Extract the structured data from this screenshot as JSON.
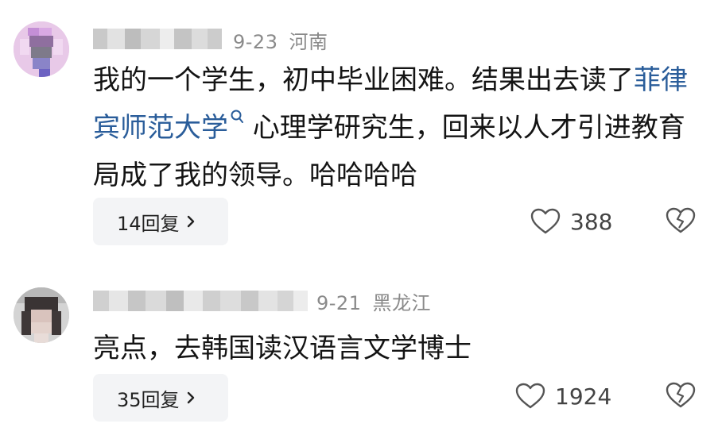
{
  "comments": [
    {
      "date": "9-23",
      "location": "河南",
      "content_before": "我的一个学生，初中毕业困难。结果出去读了",
      "link_text": "菲律宾师范大学",
      "content_after": " 心理学研究生，回来以人才引进教育局成了我的领导。哈哈哈哈",
      "reply_label": "14回复",
      "like_count": "388"
    },
    {
      "date": "9-21",
      "location": "黑龙江",
      "content_before": "亮点，去韩国读汉语言文学博士",
      "reply_label": "35回复",
      "like_count": "1924"
    }
  ],
  "icons": {
    "like": "heart-outline-icon",
    "dislike": "broken-heart-icon",
    "reply_chevron": "chevron-right-icon",
    "link": "search-icon"
  },
  "colors": {
    "link": "#2a5d9a",
    "meta": "#8a8a8a",
    "reply_bg": "#f3f4f6"
  }
}
